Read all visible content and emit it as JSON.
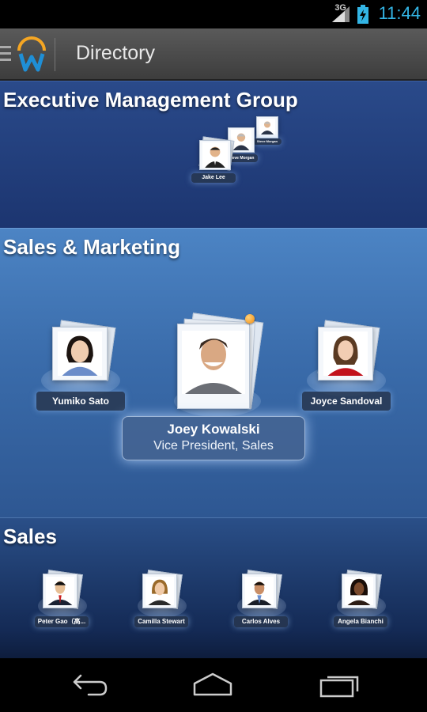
{
  "status_bar": {
    "network": "3G",
    "time": "11:44",
    "icons": [
      "signal-icon",
      "battery-charging-icon"
    ]
  },
  "action_bar": {
    "title": "Directory",
    "icons": [
      "menu-icon",
      "workday-logo"
    ]
  },
  "sections": {
    "executive": {
      "title": "Executive Management Group",
      "people": [
        {
          "name": "Jake Lee"
        },
        {
          "name": "Steve Morgan"
        },
        {
          "name": "Steve Morgan"
        }
      ]
    },
    "marketing": {
      "title": "Sales & Marketing",
      "people": [
        {
          "name": "Yumiko Sato"
        },
        {
          "name": "Joey Kowalski",
          "role": "Vice President, Sales"
        },
        {
          "name": "Joyce Sandoval"
        }
      ]
    },
    "sales": {
      "title": "Sales",
      "people": [
        {
          "name": "Peter Gao（高..."
        },
        {
          "name": "Camilla Stewart"
        },
        {
          "name": "Carlos Alves"
        },
        {
          "name": "Angela Bianchi"
        }
      ]
    }
  },
  "nav_bar": {
    "icons": [
      "back-icon",
      "home-icon",
      "recent-apps-icon"
    ]
  },
  "colors": {
    "status_accent": "#33b5e5",
    "marketing_bg": "#3a6cab",
    "executive_bg": "#22407c",
    "sales_bg": "#1c3566"
  }
}
